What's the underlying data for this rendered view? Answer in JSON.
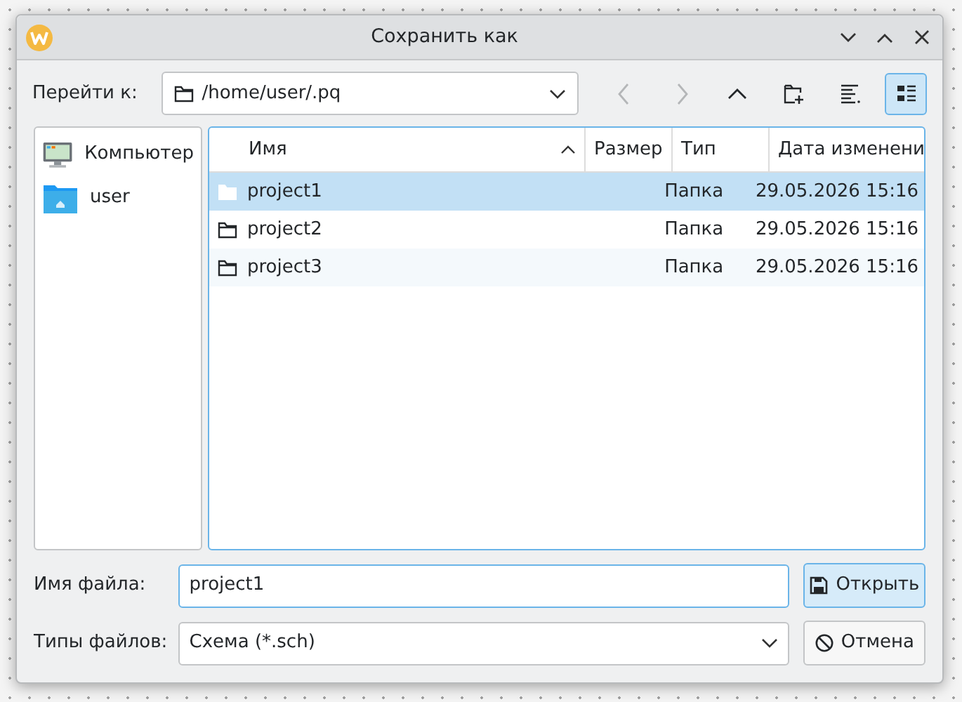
{
  "window": {
    "title": "Сохранить как"
  },
  "location": {
    "label": "Перейти к:",
    "value": "/home/user/.pq"
  },
  "toolbar": [
    {
      "kind": "back",
      "disabled": true,
      "selected": false
    },
    {
      "kind": "forward",
      "disabled": true,
      "selected": false
    },
    {
      "kind": "up",
      "disabled": false,
      "selected": false
    },
    {
      "kind": "new-folder",
      "disabled": false,
      "selected": false
    },
    {
      "kind": "details",
      "disabled": false,
      "selected": false
    },
    {
      "kind": "list",
      "disabled": false,
      "selected": true
    }
  ],
  "places": [
    {
      "kind": "computer",
      "label": "Компьютер"
    },
    {
      "kind": "home",
      "label": "user"
    }
  ],
  "table": {
    "columns": [
      "Имя",
      "Размер",
      "Тип",
      "Дата изменени"
    ],
    "rows": [
      {
        "name": "project1",
        "type": "Папка",
        "date": "29.05.2026 15:16",
        "selected": true
      },
      {
        "name": "project2",
        "type": "Папка",
        "date": "29.05.2026 15:16",
        "selected": false
      },
      {
        "name": "project3",
        "type": "Папка",
        "date": "29.05.2026 15:16",
        "selected": false
      }
    ]
  },
  "filename": {
    "label": "Имя файла:",
    "value": "project1"
  },
  "filetype": {
    "label": "Типы файлов:",
    "value": "Схема (*.sch)"
  },
  "buttons": [
    {
      "kind": "open",
      "label": "Открыть"
    },
    {
      "kind": "cancel",
      "label": "Отмена"
    }
  ]
}
